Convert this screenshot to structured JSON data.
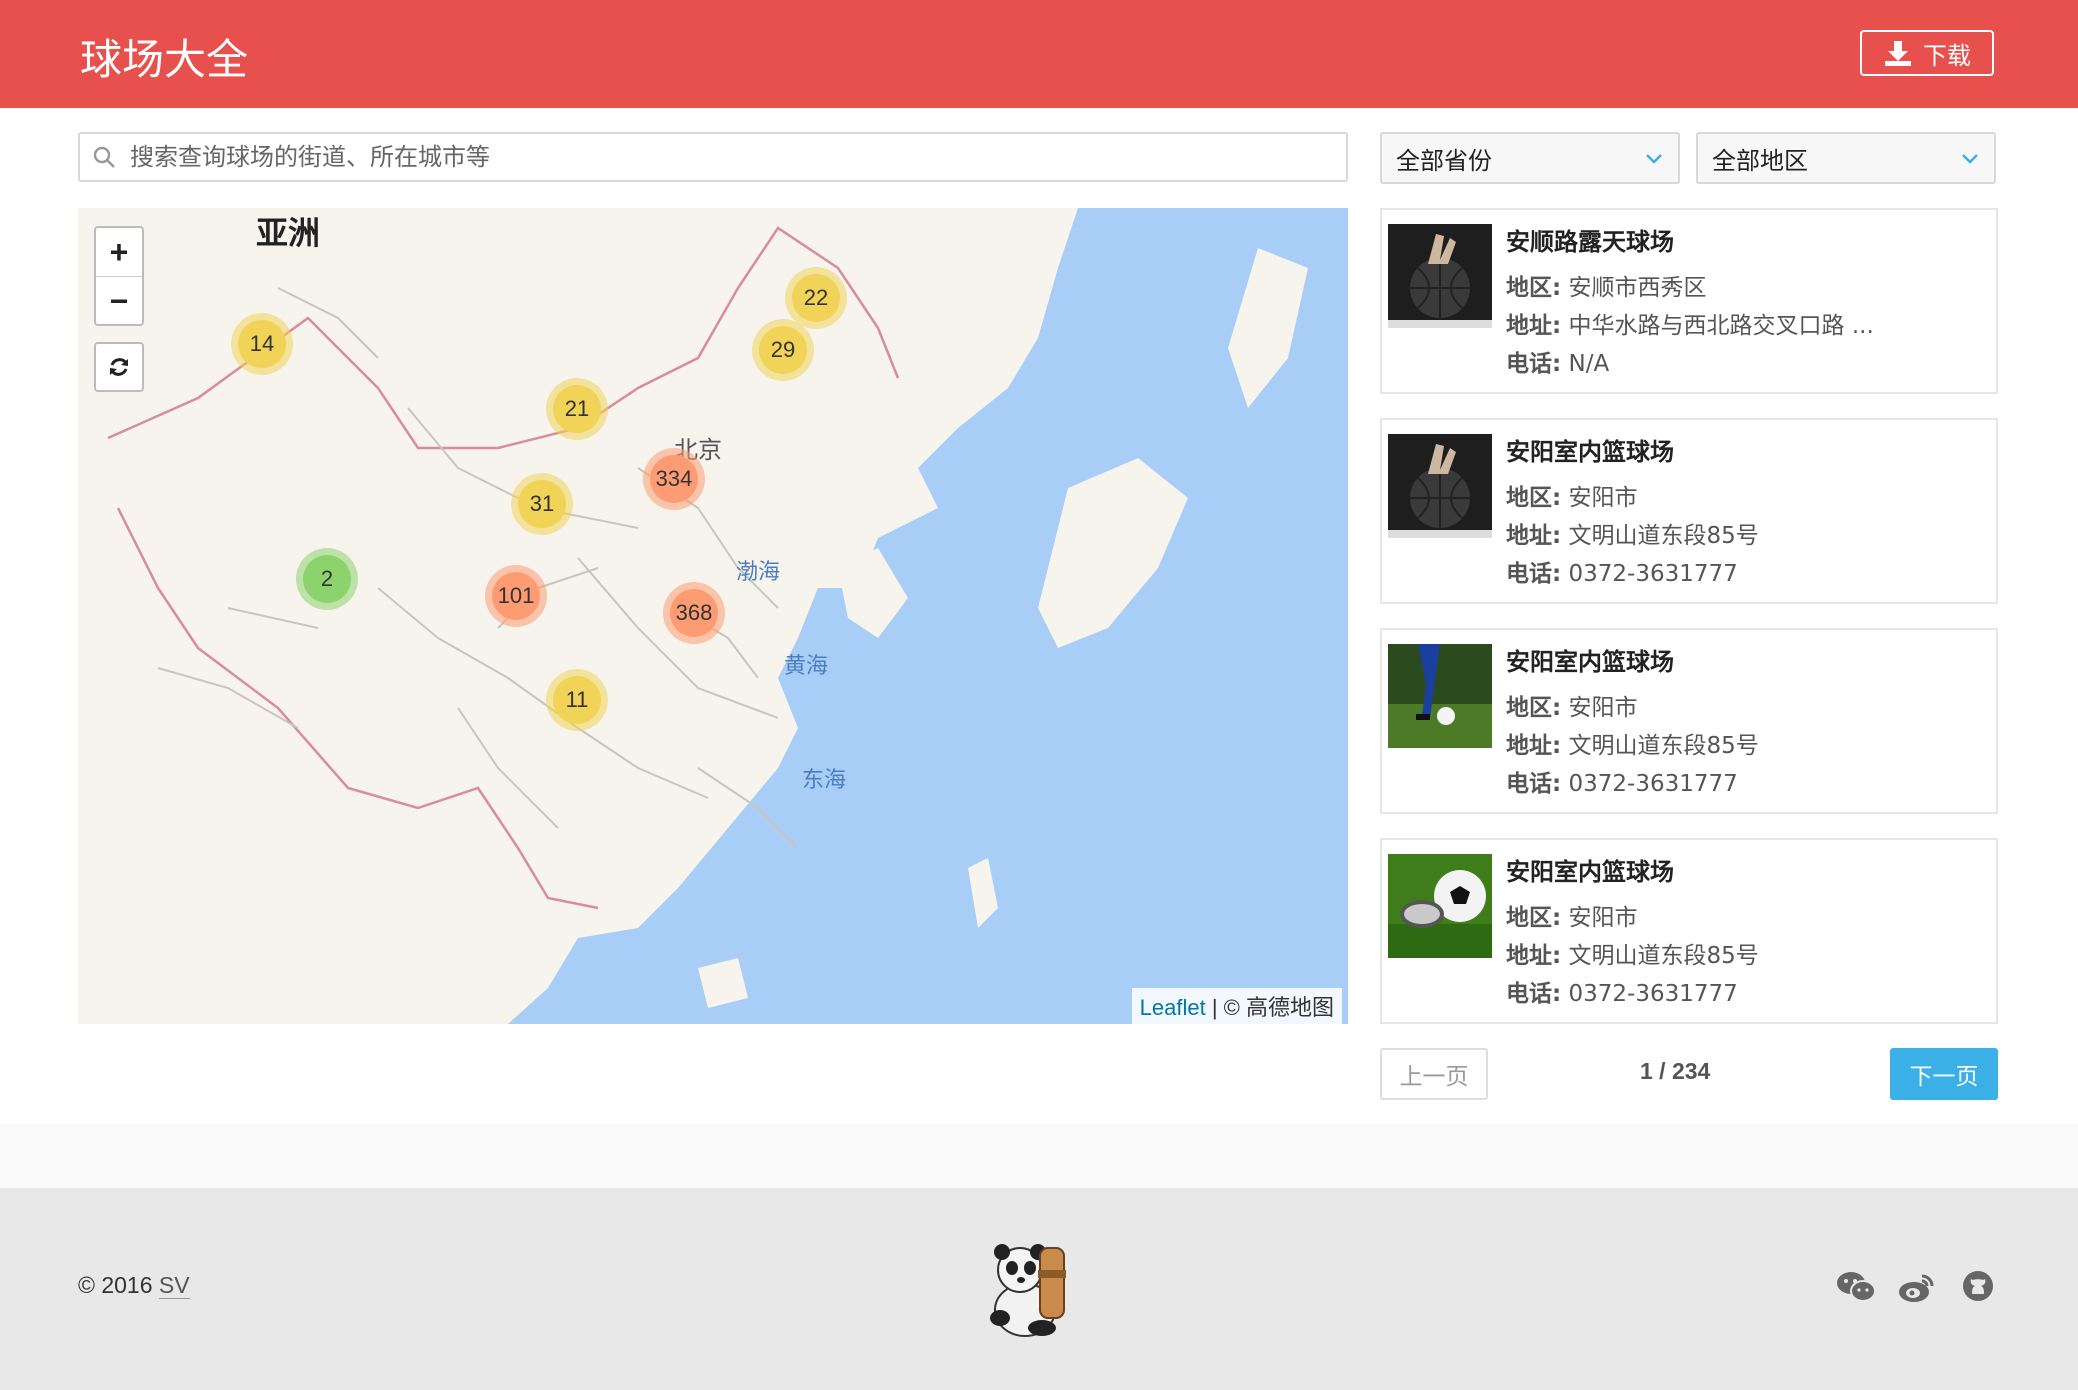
{
  "header": {
    "title": "球场大全",
    "download_label": "下载"
  },
  "search": {
    "placeholder": "搜索查询球场的街道、所在城市等"
  },
  "filters": {
    "province": "全部省份",
    "region": "全部地区"
  },
  "map": {
    "continent_label": "亚洲",
    "capital_label": "北京",
    "sea_labels": [
      "渤海",
      "黄海",
      "东海"
    ],
    "zoom_in": "+",
    "zoom_out": "−",
    "attribution_link": "Leaflet",
    "attribution_text": "| © 高德地图",
    "clusters": [
      {
        "count": "14",
        "level": "yellow"
      },
      {
        "count": "22",
        "level": "yellow"
      },
      {
        "count": "29",
        "level": "yellow"
      },
      {
        "count": "21",
        "level": "yellow"
      },
      {
        "count": "334",
        "level": "orange"
      },
      {
        "count": "31",
        "level": "yellow"
      },
      {
        "count": "2",
        "level": "green"
      },
      {
        "count": "101",
        "level": "orange"
      },
      {
        "count": "368",
        "level": "orange"
      },
      {
        "count": "11",
        "level": "yellow"
      }
    ]
  },
  "courts": [
    {
      "name": "安顺路露天球场",
      "region_label": "地区:",
      "region": "安顺市西秀区",
      "address_label": "地址:",
      "address": "中华水路与西北路交叉口路 ...",
      "phone_label": "电话:",
      "phone": "N/A",
      "thumb": "basketball-hand"
    },
    {
      "name": "安阳室内篮球场",
      "region_label": "地区:",
      "region": "安阳市",
      "address_label": "地址:",
      "address": "文明山道东段85号",
      "phone_label": "电话:",
      "phone": "0372-3631777",
      "thumb": "basketball-hand"
    },
    {
      "name": "安阳室内篮球场",
      "region_label": "地区:",
      "region": "安阳市",
      "address_label": "地址:",
      "address": "文明山道东段85号",
      "phone_label": "电话:",
      "phone": "0372-3631777",
      "thumb": "soccer-player"
    },
    {
      "name": "安阳室内篮球场",
      "region_label": "地区:",
      "region": "安阳市",
      "address_label": "地址:",
      "address": "文明山道东段85号",
      "phone_label": "电话:",
      "phone": "0372-3631777",
      "thumb": "soccer-ball"
    }
  ],
  "pager": {
    "prev": "上一页",
    "info": "1 / 234",
    "next": "下一页"
  },
  "footer": {
    "copyright": "© 2016",
    "author": "SV",
    "social_icons": [
      "wechat-icon",
      "weibo-icon",
      "github-icon"
    ]
  },
  "colors": {
    "header": "#e8504d",
    "next_button": "#3ab0e6",
    "cluster_yellow": "#f1d357",
    "cluster_orange": "#fd9c73",
    "cluster_green": "#8cd36e"
  }
}
